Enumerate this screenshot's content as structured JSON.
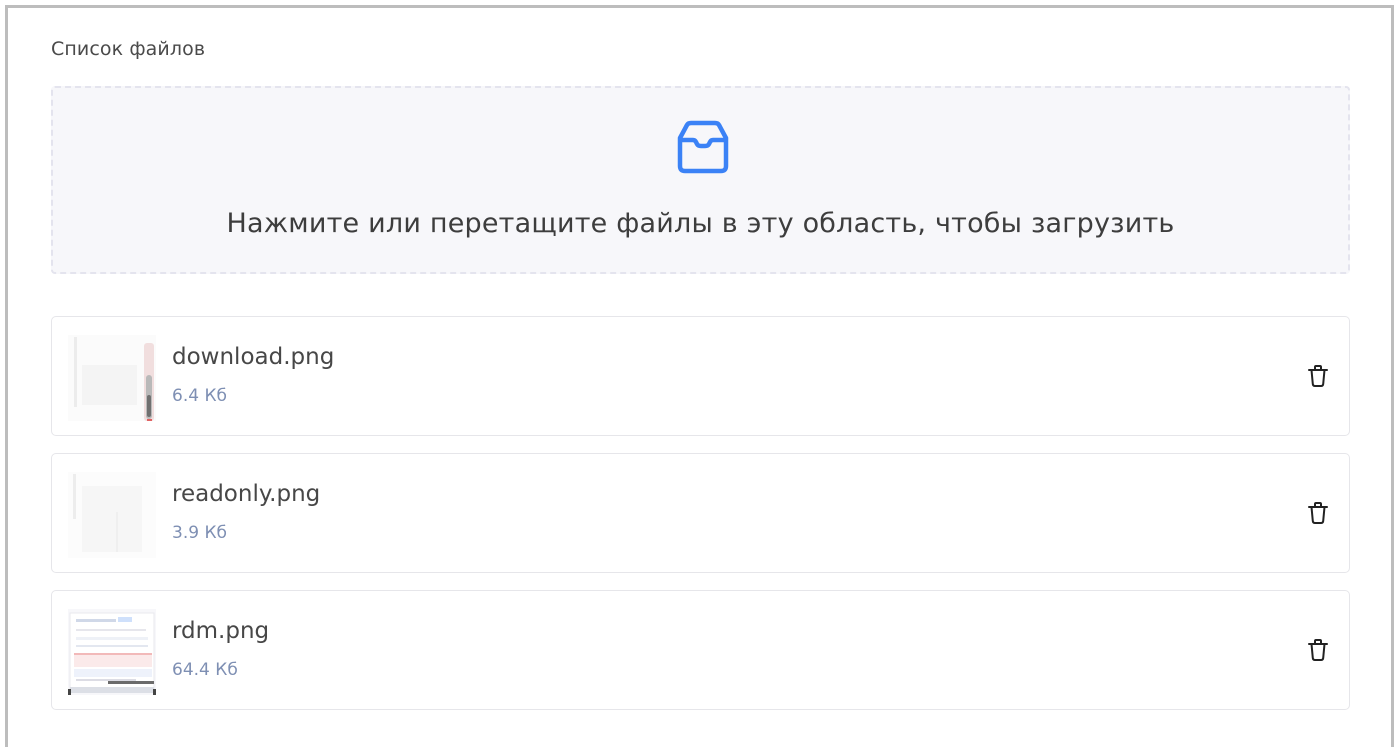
{
  "section": {
    "title": "Список файлов"
  },
  "dropzone": {
    "icon": "inbox-icon",
    "text": "Нажмите или перетащите файлы в эту область, чтобы загрузить",
    "accent": "#3b82f6"
  },
  "files": [
    {
      "name": "download.png",
      "size": "6.4 Кб",
      "thumbnail": "image-thumbnail",
      "action_icon": "trash-icon"
    },
    {
      "name": "readonly.png",
      "size": "3.9 Кб",
      "thumbnail": "image-thumbnail",
      "action_icon": "trash-icon"
    },
    {
      "name": "rdm.png",
      "size": "64.4 Кб",
      "thumbnail": "image-thumbnail",
      "action_icon": "trash-icon"
    }
  ],
  "colors": {
    "title": "#4a4a4a",
    "dropzone_bg": "#f7f7fa",
    "size_text": "#7e8fb3"
  }
}
